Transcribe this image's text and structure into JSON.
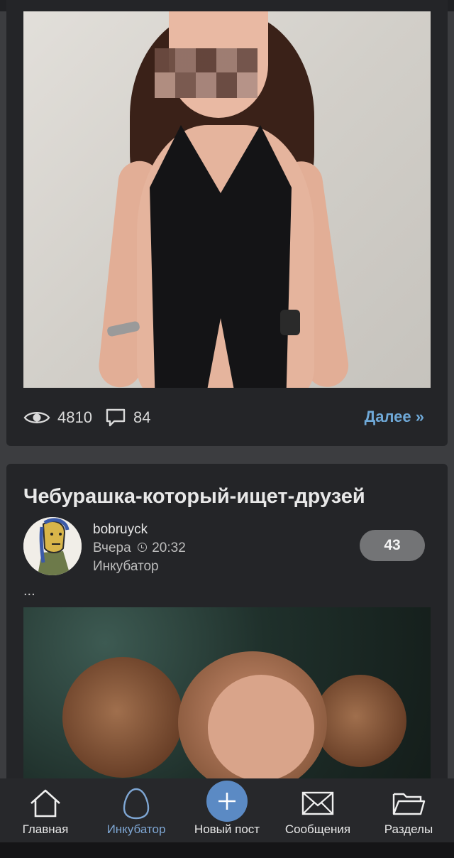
{
  "post1": {
    "views": "4810",
    "comments": "84",
    "more_label": "Далее »"
  },
  "post2": {
    "title": "Чебурашка-который-ищет-друзей",
    "author": "bobruyck",
    "date_label": "Вчера",
    "time": "20:32",
    "section": "Инкубатор",
    "rating": "43",
    "excerpt": "..."
  },
  "nav": {
    "items": [
      {
        "label": "Главная",
        "icon": "home-icon"
      },
      {
        "label": "Инкубатор",
        "icon": "egg-icon",
        "active": true
      },
      {
        "label": "Новый пост",
        "icon": "plus-icon"
      },
      {
        "label": "Сообщения",
        "icon": "envelope-icon"
      },
      {
        "label": "Разделы",
        "icon": "folder-icon"
      }
    ]
  },
  "colors": {
    "background": "#3c3d40",
    "card": "#242528",
    "link": "#6fa9d8",
    "active_nav": "#7ea6d3",
    "accent_button": "#5b8ac4",
    "rating_badge": "#737476"
  }
}
